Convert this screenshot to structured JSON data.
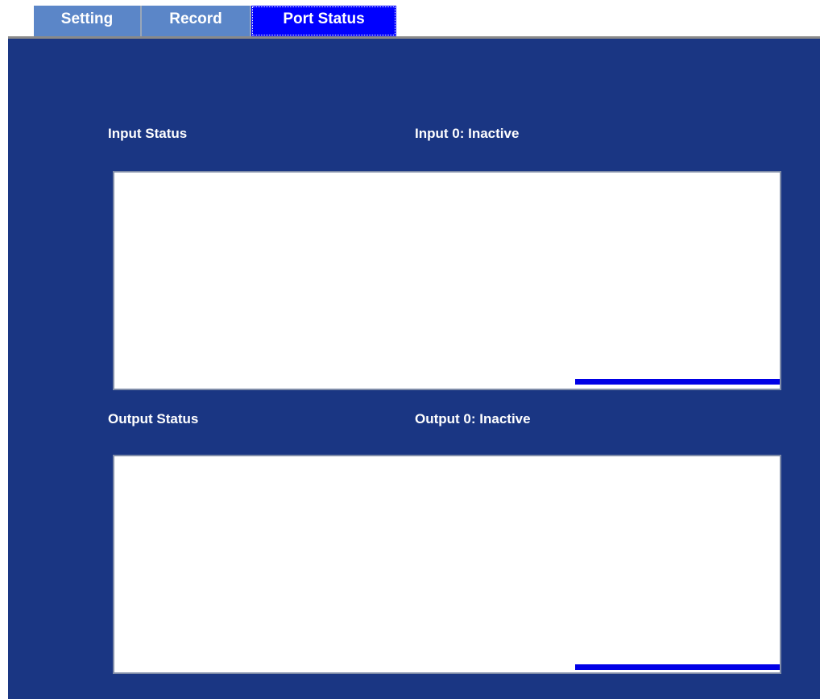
{
  "tabs": [
    {
      "label": "Setting",
      "active": false
    },
    {
      "label": "Record",
      "active": false
    },
    {
      "label": "Port Status",
      "active": true
    }
  ],
  "input": {
    "heading": "Input Status",
    "state_text": "Input 0: Inactive"
  },
  "output": {
    "heading": "Output Status",
    "state_text": "Output 0: Inactive"
  },
  "colors": {
    "panel_background": "#1a3683",
    "active_tab": "#0000ff",
    "inactive_tab": "#5b86c8",
    "indicator_bar": "#0000e6"
  }
}
